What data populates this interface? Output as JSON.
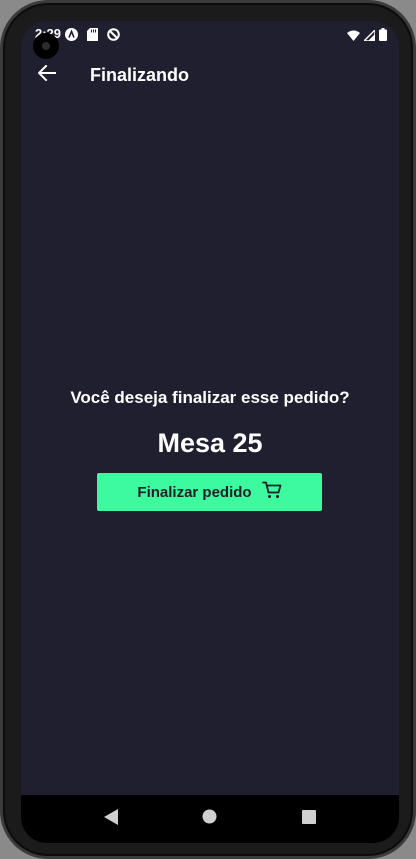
{
  "status_bar": {
    "time": "2:29",
    "left_icons": [
      "android-app-icon",
      "sd-card-icon",
      "sync-disabled-icon"
    ],
    "right_icons": [
      "wifi-icon",
      "signal-icon",
      "battery-icon"
    ]
  },
  "app_bar": {
    "title": "Finalizando",
    "back_icon": "arrow-left-icon"
  },
  "main": {
    "question": "Você deseja finalizar esse pedido?",
    "table_name": "Mesa 25",
    "finish_button": {
      "label": "Finalizar pedido",
      "icon": "cart-icon"
    }
  },
  "nav_bar": {
    "buttons": [
      "back-triangle-icon",
      "home-circle-icon",
      "recents-square-icon"
    ]
  },
  "colors": {
    "background": "#1f1f2f",
    "accent": "#3dfa9f",
    "text": "#ffffff",
    "button_text": "#1d1d2b"
  }
}
